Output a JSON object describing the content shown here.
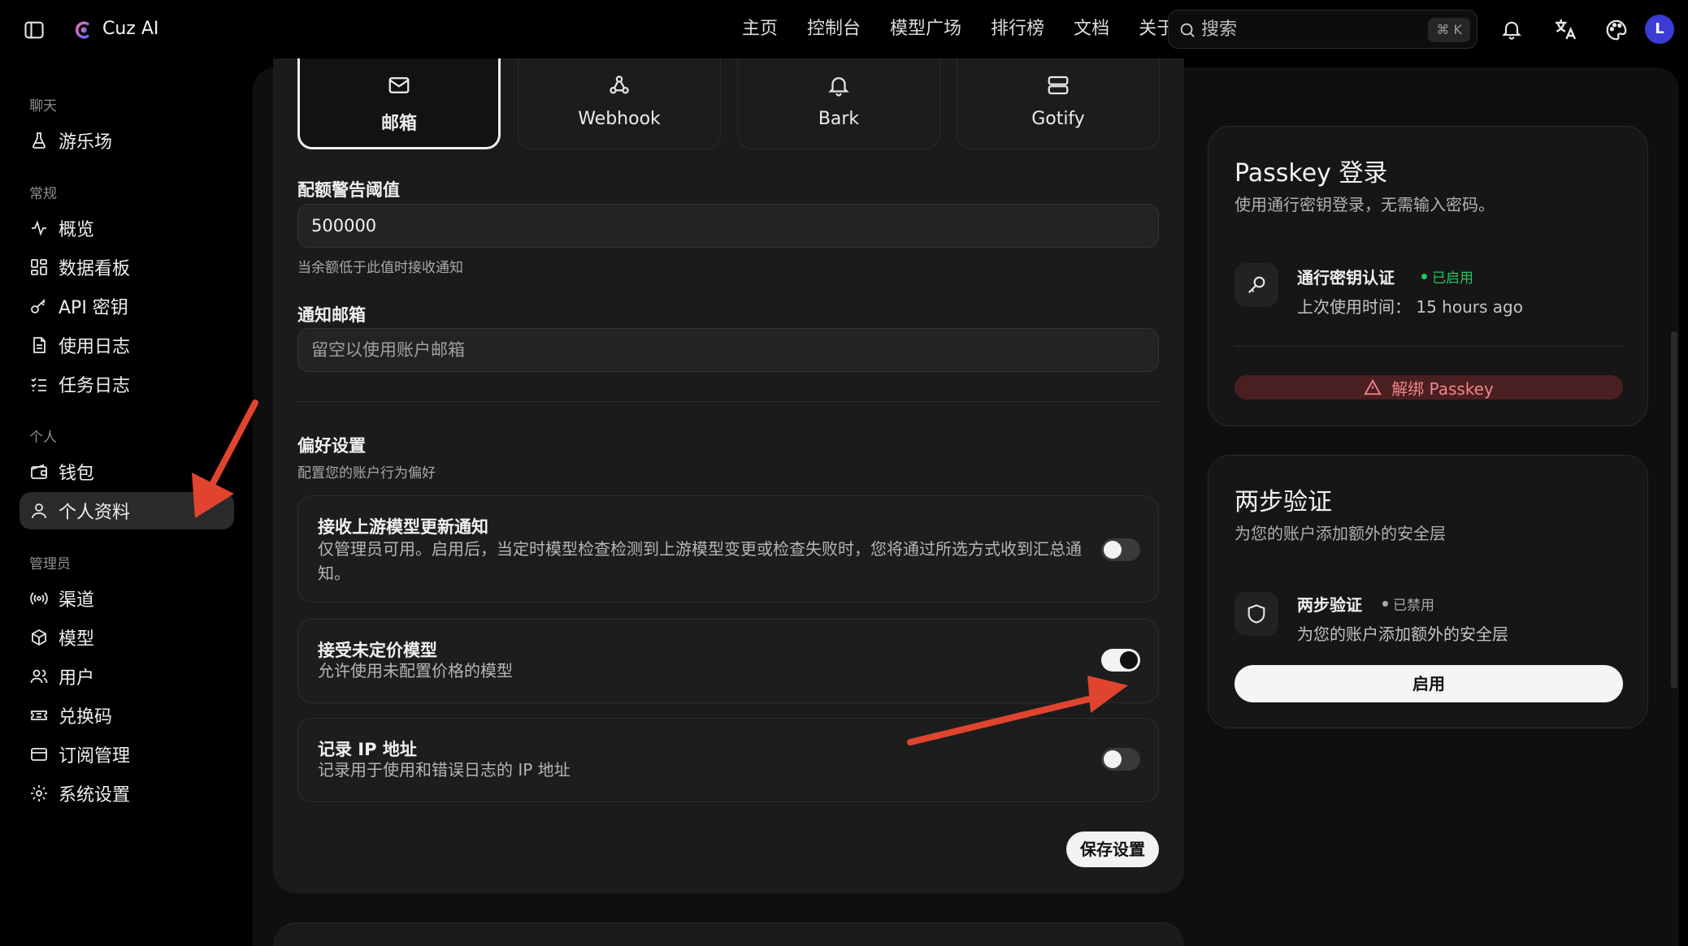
{
  "app": {
    "title": "Cuz AI",
    "avatar_initial": "L"
  },
  "nav": [
    "主页",
    "控制台",
    "模型广场",
    "排行榜",
    "文档",
    "关于"
  ],
  "search": {
    "placeholder": "搜索",
    "shortcut": "⌘ K"
  },
  "sidebar": {
    "sections": {
      "chat": "聊天",
      "general": "常规",
      "personal": "个人",
      "admin": "管理员"
    },
    "items": {
      "playground": "游乐场",
      "overview": "概览",
      "dashboard": "数据看板",
      "api_keys": "API 密钥",
      "usage_logs": "使用日志",
      "task_logs": "任务日志",
      "wallet": "钱包",
      "profile": "个人资料",
      "channels": "渠道",
      "models": "模型",
      "users": "用户",
      "redeem_codes": "兑换码",
      "subscriptions": "订阅管理",
      "system_settings": "系统设置"
    },
    "active": "profile"
  },
  "notify_tabs": [
    {
      "label": "邮箱",
      "icon": "mail-icon",
      "active": true
    },
    {
      "label": "Webhook",
      "icon": "webhook-icon",
      "active": false
    },
    {
      "label": "Bark",
      "icon": "bell-icon",
      "active": false
    },
    {
      "label": "Gotify",
      "icon": "server-icon",
      "active": false
    }
  ],
  "quota": {
    "label": "配额警告阈值",
    "value": "500000",
    "help": "当余额低于此值时接收通知"
  },
  "notify_email": {
    "label": "通知邮箱",
    "placeholder": "留空以使用账户邮箱"
  },
  "preferences": {
    "title": "偏好设置",
    "subtitle": "配置您的账户行为偏好",
    "items": [
      {
        "title": "接收上游模型更新通知",
        "desc": "仅管理员可用。启用后，当定时模型检查检测到上游模型变更或检查失败时，您将通过所选方式收到汇总通知。",
        "enabled": false
      },
      {
        "title": "接受未定价模型",
        "desc": "允许使用未配置价格的模型",
        "enabled": true
      },
      {
        "title": "记录 IP 地址",
        "desc": "记录用于使用和错误日志的 IP 地址",
        "enabled": false
      }
    ],
    "save_label": "保存设置"
  },
  "passkey": {
    "title": "Passkey 登录",
    "subtitle": "使用通行密钥登录，无需输入密码。",
    "item_title": "通行密钥认证",
    "status": "已启用",
    "status_color": "#22c55e",
    "last_used": "上次使用时间： 15 hours ago",
    "unbind_label": "解绑 Passkey"
  },
  "two_factor": {
    "title": "两步验证",
    "subtitle": "为您的账户添加额外的安全层",
    "item_title": "两步验证",
    "status": "已禁用",
    "status_color": "#9a9a9a",
    "item_desc": "为您的账户添加额外的安全层",
    "enable_label": "启用"
  },
  "colors": {
    "accent_red_arrow": "#e0442f",
    "avatar": "#3b3bd6",
    "danger": "#f08585"
  }
}
